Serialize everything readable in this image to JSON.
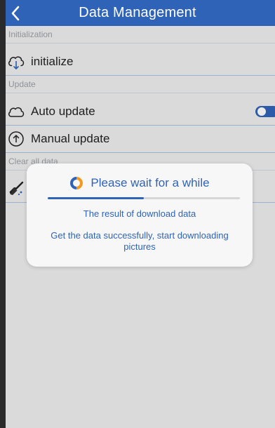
{
  "header": {
    "title": "Data Management"
  },
  "sections": {
    "initialization": {
      "label": "Initialization",
      "items": [
        {
          "label": "initialize",
          "icon": "cloud-download-icon"
        }
      ]
    },
    "update": {
      "label": "Update",
      "items": [
        {
          "label": "Auto update",
          "icon": "cloud-icon",
          "toggle_on": true
        },
        {
          "label": "Manual update",
          "icon": "arrow-up-circle-icon"
        }
      ]
    },
    "clear": {
      "label": "Clear all data",
      "icon": "broom-icon"
    }
  },
  "dialog": {
    "title": "Please wait for a while",
    "spinner_icon": "spinner-icon",
    "progress": 0.5,
    "line1": "The result of download data",
    "line2": "Get the data successfully, start downloading pictures"
  },
  "colors": {
    "primary": "#2f63b8",
    "background": "#ededed",
    "divider": "#a8c2e0",
    "section_text": "#9aa0a6"
  }
}
